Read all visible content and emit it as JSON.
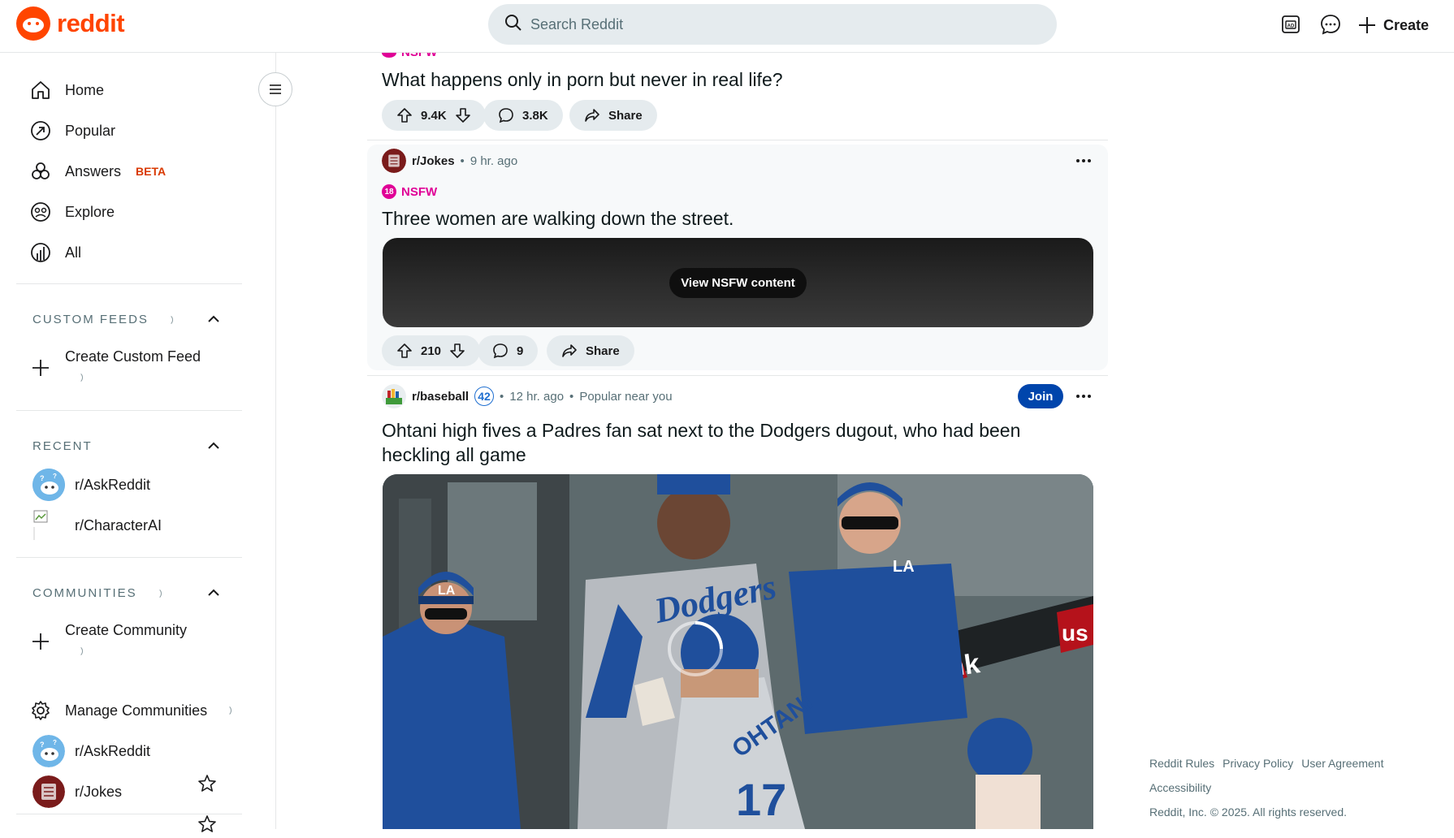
{
  "header": {
    "logo_text": "reddit",
    "search_placeholder": "Search Reddit",
    "create_label": "Create"
  },
  "sidebar": {
    "nav": [
      {
        "label": "Home",
        "icon": "home-icon"
      },
      {
        "label": "Popular",
        "icon": "popular-icon"
      },
      {
        "label": "Answers",
        "icon": "answers-icon",
        "badge": "BETA"
      },
      {
        "label": "Explore",
        "icon": "explore-icon"
      },
      {
        "label": "All",
        "icon": "all-icon"
      }
    ],
    "custom_feeds": {
      "title": "CUSTOM FEEDS",
      "create_label": "Create Custom Feed"
    },
    "recent": {
      "title": "RECENT",
      "items": [
        {
          "label": "r/AskReddit"
        },
        {
          "label": "r/CharacterAI"
        }
      ]
    },
    "communities": {
      "title": "COMMUNITIES",
      "create_label": "Create Community",
      "manage_label": "Manage Communities",
      "items": [
        {
          "label": "r/AskReddit"
        },
        {
          "label": "r/Jokes"
        }
      ]
    }
  },
  "feed": {
    "post1": {
      "nsfw_label": "NSFW",
      "title": "What happens only in porn but never in real life?",
      "votes": "9.4K",
      "comments": "3.8K",
      "share_label": "Share"
    },
    "post2": {
      "subreddit": "r/Jokes",
      "age": "9 hr. ago",
      "nsfw_label": "NSFW",
      "nsfw_badge": "18",
      "title": "Three women are walking down the street.",
      "nsfw_button": "View NSFW content",
      "votes": "210",
      "comments": "9",
      "share_label": "Share"
    },
    "post3": {
      "subreddit": "r/baseball",
      "flair": "42",
      "age": "12 hr. ago",
      "extra": "Popular near you",
      "join_label": "Join",
      "title_line1": "Ohtani high fives a Padres fan sat next to the Dodgers dugout, who had been",
      "title_line2": "heckling all game",
      "media_text": {
        "jersey": "Dodgers",
        "sign": "us bank",
        "sign2": "us",
        "player": "OHTANI",
        "number": "17",
        "cap_logo": "LA"
      }
    }
  },
  "footer": {
    "links": [
      "Reddit Rules",
      "Privacy Policy",
      "User Agreement",
      "Accessibility"
    ],
    "copyright": "Reddit, Inc. © 2025. All rights reserved."
  }
}
